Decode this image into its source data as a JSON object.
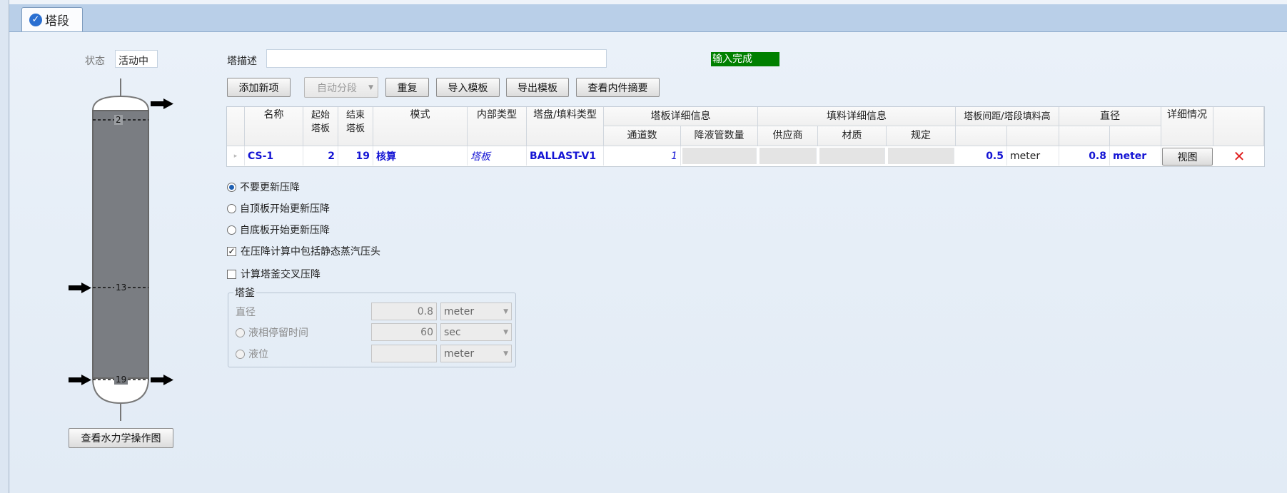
{
  "tab": {
    "label": "塔段"
  },
  "status": {
    "label": "状态",
    "value": "活动中"
  },
  "description": {
    "label": "塔描述",
    "value": ""
  },
  "completion": {
    "text": "输入完成",
    "color": "#008000"
  },
  "toolbar": {
    "add": "添加新项",
    "auto_segment": "自动分段",
    "repeat": "重复",
    "import_template": "导入模板",
    "export_template": "导出模板",
    "internals_summary": "查看内件摘要"
  },
  "grid": {
    "headers": {
      "name": "名称",
      "start_stage": "起始塔板",
      "end_stage": "结束塔板",
      "mode": "模式",
      "internal_type": "内部类型",
      "tray_type": "塔盘/填料类型",
      "tray_detail": "塔板详细信息",
      "passes": "通道数",
      "downcomers": "降液管数量",
      "packing_detail": "填料详细信息",
      "vendor": "供应商",
      "material": "材质",
      "spec": "规定",
      "spacing": "塔板间距/塔段填料高",
      "diameter": "直径",
      "details": "详细情况"
    },
    "row": {
      "name": "CS-1",
      "start": "2",
      "end": "19",
      "mode": "核算",
      "internal_type": "塔板",
      "tray_type": "BALLAST-V1",
      "passes": "1",
      "spacing": "0.5",
      "spacing_unit": "meter",
      "diameter": "0.8",
      "diameter_unit": "meter",
      "view": "视图",
      "delete_icon": "red-x"
    }
  },
  "options": {
    "no_update": "不要更新压降",
    "from_top": "自顶板开始更新压降",
    "from_bottom": "自底板开始更新压降",
    "include_static": "在压降计算中包括静态蒸汽压头",
    "sump_cross": "计算塔釜交叉压降",
    "selected": "no_update",
    "include_static_checked": true,
    "sump_cross_checked": false
  },
  "sump": {
    "title": "塔釜",
    "diameter_label": "直径",
    "diameter_value": "0.8",
    "diameter_unit": "meter",
    "residence_label": "液相停留时间",
    "residence_value": "60",
    "residence_unit": "sec",
    "level_label": "液位",
    "level_value": "",
    "level_unit": "meter"
  },
  "column_diagram": {
    "stages": [
      "2",
      "13",
      "19"
    ]
  },
  "hydraulics_button": "查看水力学操作图"
}
